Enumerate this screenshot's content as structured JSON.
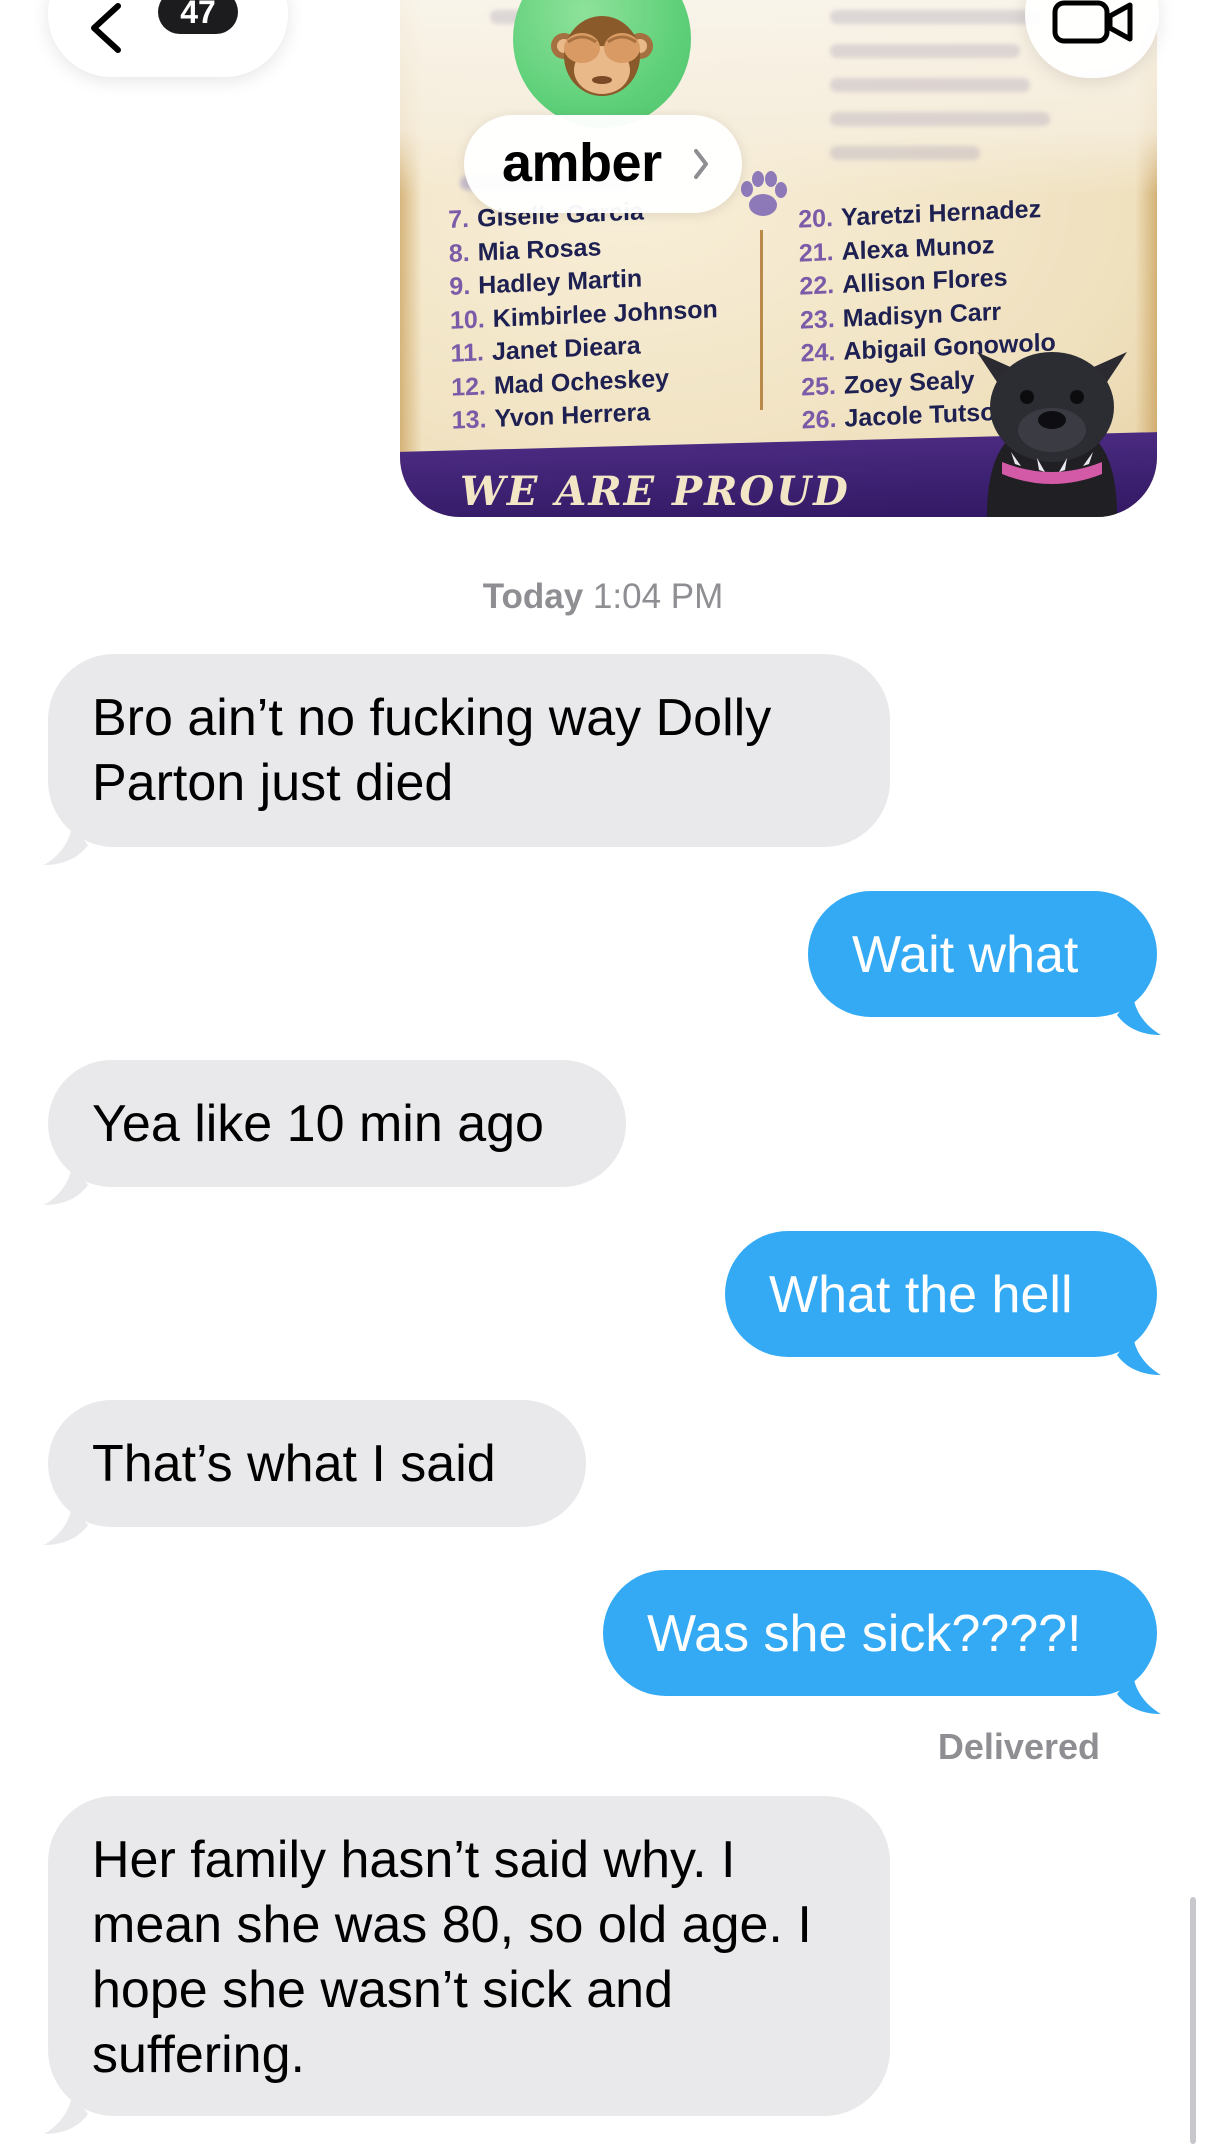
{
  "header": {
    "unread_count": "47",
    "contact_name": "amber",
    "avatar_icon": "see-no-evil-monkey-icon",
    "video_icon": "video-camera-icon"
  },
  "shared_image": {
    "roster_left": [
      {
        "num": "7.",
        "name": "Giselle Garcia"
      },
      {
        "num": "8.",
        "name": "Mia Rosas"
      },
      {
        "num": "9.",
        "name": "Hadley Martin"
      },
      {
        "num": "10.",
        "name": "Kimbirlee Johnson"
      },
      {
        "num": "11.",
        "name": "Janet Dieara"
      },
      {
        "num": "12.",
        "name": "Mad Ocheskey"
      },
      {
        "num": "13.",
        "name": "Yvon Herrera"
      }
    ],
    "roster_right": [
      {
        "num": "20.",
        "name": "Yaretzi Hernadez"
      },
      {
        "num": "21.",
        "name": "Alexa Munoz"
      },
      {
        "num": "22.",
        "name": "Allison Flores"
      },
      {
        "num": "23.",
        "name": "Madisyn Carr"
      },
      {
        "num": "24.",
        "name": "Abigail Gonowolo"
      },
      {
        "num": "25.",
        "name": "Zoey Sealy"
      },
      {
        "num": "26.",
        "name": "Jacole Tutson"
      }
    ],
    "banner_text": "WE ARE PROUD",
    "colors": {
      "banner": "#2e1660",
      "paper": "#efe0bd",
      "text": "#1d2050"
    }
  },
  "timestamp": {
    "day": "Today",
    "time": "1:04 PM"
  },
  "messages": [
    {
      "direction": "incoming",
      "text": "Bro ain’t no fucking way Dolly Parton just died"
    },
    {
      "direction": "outgoing",
      "text": "Wait what"
    },
    {
      "direction": "incoming",
      "text": "Yea like 10 min ago"
    },
    {
      "direction": "outgoing",
      "text": "What the hell"
    },
    {
      "direction": "incoming",
      "text": "That’s what I said"
    },
    {
      "direction": "outgoing",
      "text": "Was she sick????!"
    },
    {
      "direction": "incoming",
      "text": "Her family hasn’t said why. I mean she was 80, so old age. I hope she wasn’t sick and suffering."
    }
  ],
  "delivery_status": "Delivered",
  "colors": {
    "outgoing_bubble": "#34aaf4",
    "incoming_bubble": "#e9e9eb",
    "secondary_text": "#8e8e93"
  }
}
